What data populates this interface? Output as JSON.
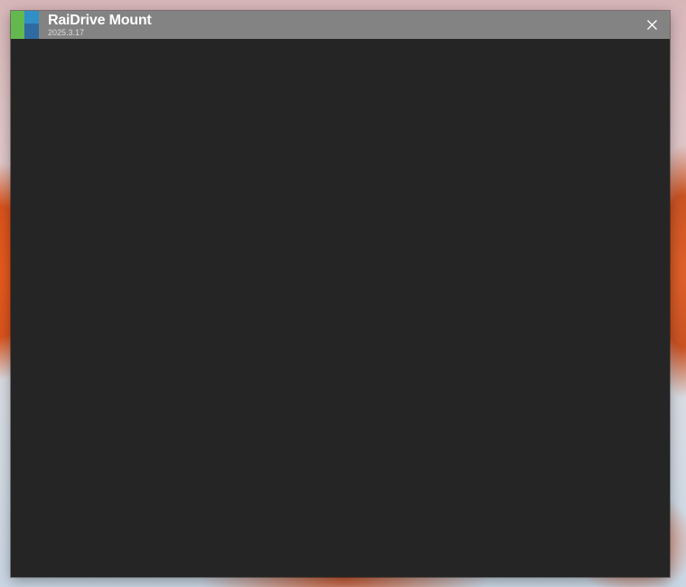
{
  "window": {
    "title": "RaiDrive Mount",
    "version": "2025.3.17"
  },
  "icons": {
    "app_logo": "raidrive-logo-icon",
    "close": "close-icon"
  },
  "colors": {
    "titlebar": "#838383",
    "content_background": "#252525",
    "logo_green": "#63b84e",
    "logo_blue": "#2f8fc6"
  }
}
